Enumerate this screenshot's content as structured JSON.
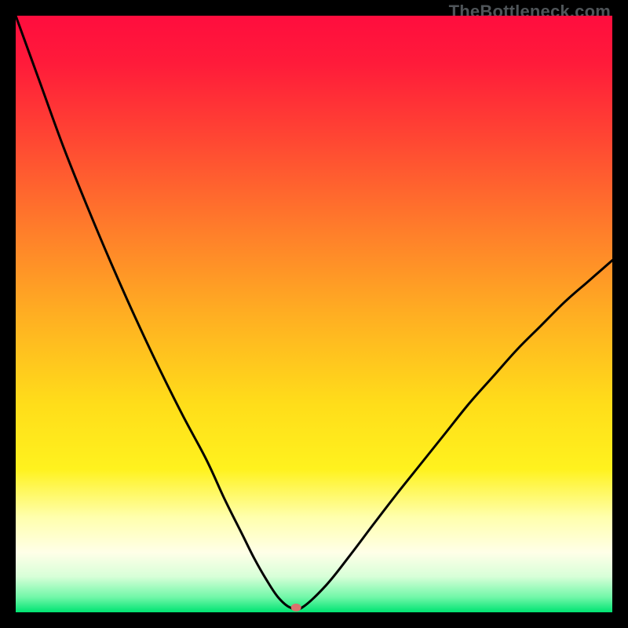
{
  "watermark": "TheBottleneck.com",
  "chart_data": {
    "type": "line",
    "title": "",
    "xlabel": "",
    "ylabel": "",
    "xlim": [
      0,
      100
    ],
    "ylim": [
      0,
      100
    ],
    "grid": false,
    "legend": false,
    "series": [
      {
        "name": "bottleneck-curve",
        "color": "#000000",
        "x": [
          0,
          4,
          8,
          12,
          16,
          20,
          24,
          28,
          32,
          35,
          38,
          40,
          42,
          44,
          46,
          48,
          52,
          56,
          60,
          64,
          68,
          72,
          76,
          80,
          84,
          88,
          92,
          96,
          100
        ],
        "y": [
          100,
          89,
          78,
          68,
          58.5,
          49.5,
          41,
          33,
          25.5,
          19,
          13,
          9,
          5.5,
          2.5,
          0.8,
          0.8,
          4.5,
          9.5,
          14.8,
          20,
          25,
          30,
          35,
          39.5,
          44,
          48,
          52,
          55.5,
          59
        ]
      }
    ],
    "marker": {
      "name": "optimum-point",
      "x": 47,
      "y": 0.8,
      "color": "#d9716d",
      "rx": 6.5,
      "ry": 5
    },
    "background_gradient": {
      "stops": [
        {
          "offset": 0.0,
          "color": "#ff0d3e"
        },
        {
          "offset": 0.08,
          "color": "#ff1b3a"
        },
        {
          "offset": 0.2,
          "color": "#ff4433"
        },
        {
          "offset": 0.35,
          "color": "#ff7a2b"
        },
        {
          "offset": 0.5,
          "color": "#ffae22"
        },
        {
          "offset": 0.65,
          "color": "#ffdd1a"
        },
        {
          "offset": 0.76,
          "color": "#fff21e"
        },
        {
          "offset": 0.84,
          "color": "#ffffac"
        },
        {
          "offset": 0.9,
          "color": "#ffffe8"
        },
        {
          "offset": 0.94,
          "color": "#d8ffd8"
        },
        {
          "offset": 0.975,
          "color": "#70f7a8"
        },
        {
          "offset": 1.0,
          "color": "#00e472"
        }
      ]
    }
  }
}
